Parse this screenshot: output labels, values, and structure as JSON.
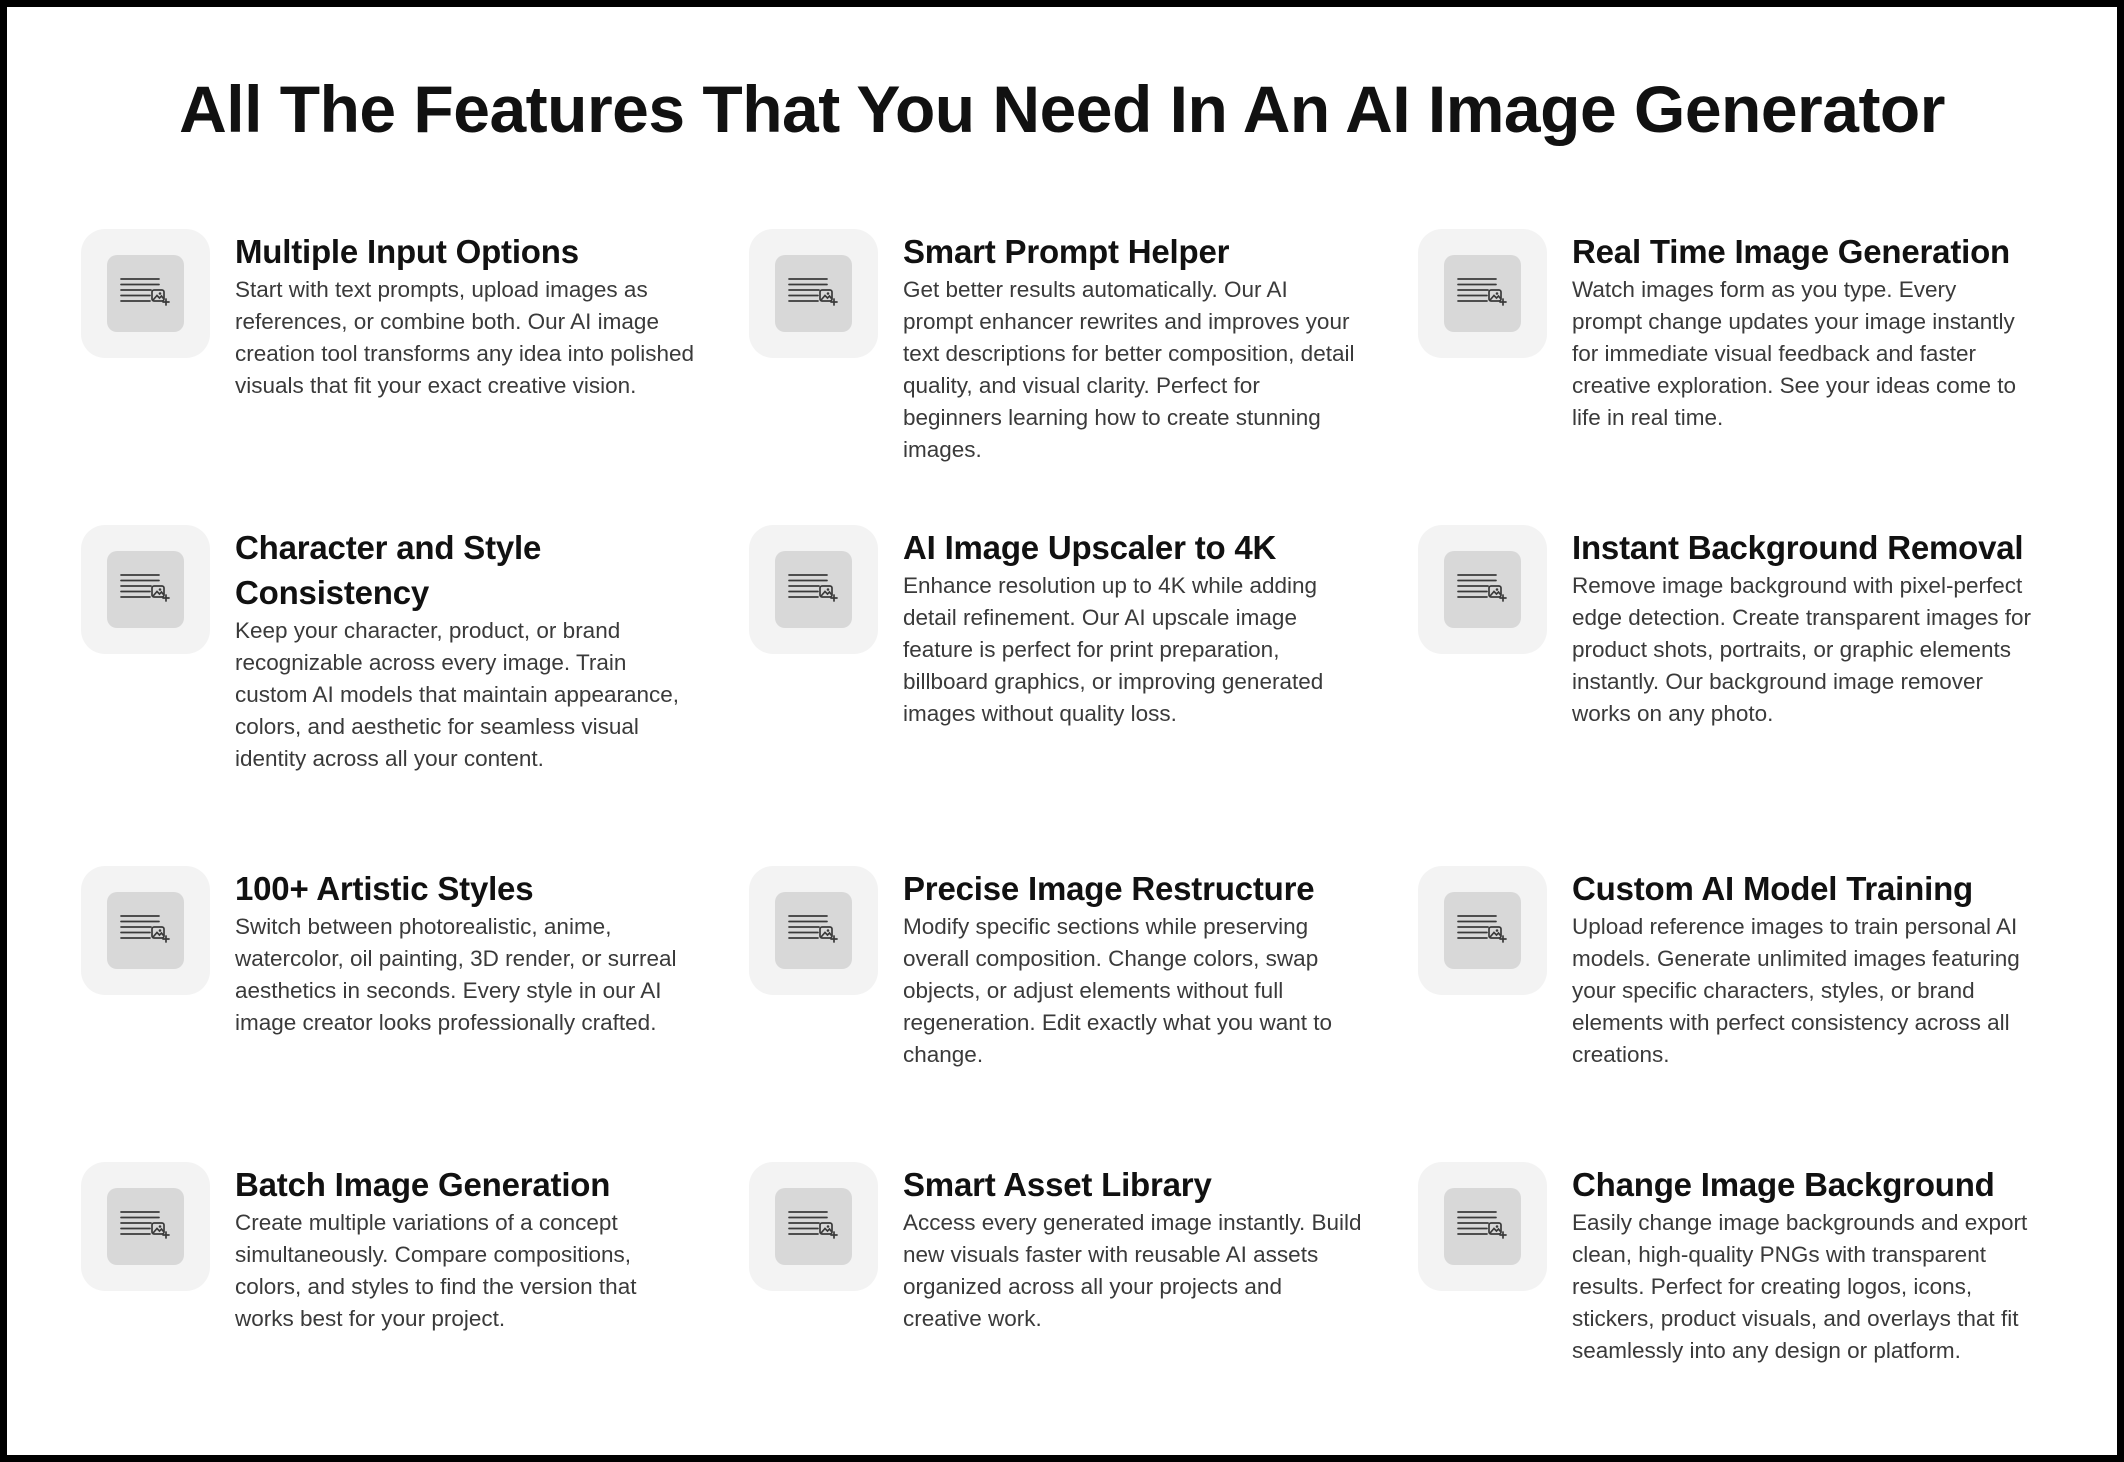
{
  "page": {
    "title": "All The Features That You Need In An AI Image Generator"
  },
  "icon_name": "text-to-image-icon",
  "features": [
    {
      "title": "Multiple Input Options",
      "description": "Start with text prompts, upload images as references, or combine both. Our AI image creation tool transforms any idea into polished visuals that fit your exact creative vision."
    },
    {
      "title": "Smart Prompt Helper",
      "description": "Get better results automatically. Our AI prompt enhancer rewrites and improves your text descriptions for better composition, detail quality, and visual clarity. Perfect for beginners learning how to create stunning images."
    },
    {
      "title": "Real Time Image Generation",
      "description": "Watch images form as you type. Every prompt change updates your image instantly for immediate visual feedback and faster creative exploration. See your ideas come to life in real time."
    },
    {
      "title": "Character and Style Consistency",
      "description": "Keep your character, product, or brand recognizable across every image. Train custom AI models that maintain appearance, colors, and aesthetic for seamless visual identity across all your content."
    },
    {
      "title": "AI Image Upscaler to 4K",
      "description": "Enhance resolution up to 4K while adding detail refinement. Our AI upscale image feature is perfect for print preparation, billboard graphics, or improving generated images without quality loss."
    },
    {
      "title": "Instant Background Removal",
      "description": "Remove image background with pixel-perfect edge detection. Create transparent images for product shots, portraits, or graphic elements instantly. Our background image remover works on any photo."
    },
    {
      "title": "100+ Artistic Styles",
      "description": "Switch between photorealistic, anime, watercolor, oil painting, 3D render, or surreal aesthetics in seconds. Every style in our AI image creator looks professionally crafted."
    },
    {
      "title": "Precise Image Restructure",
      "description": "Modify specific sections while preserving overall composition. Change colors, swap objects, or adjust elements without full regeneration. Edit exactly what you want to change."
    },
    {
      "title": "Custom AI Model Training",
      "description": "Upload reference images to train personal AI models. Generate unlimited images featuring your specific characters, styles, or brand elements with perfect consistency across all creations."
    },
    {
      "title": "Batch Image Generation",
      "description": "Create multiple variations of a concept simultaneously. Compare compositions, colors, and styles to find the version that works best for your project."
    },
    {
      "title": "Smart Asset Library",
      "description": "Access every generated image instantly. Build new visuals faster with reusable AI assets organized across all your projects and creative work."
    },
    {
      "title": "Change Image Background",
      "description": "Easily change image backgrounds and export clean, high-quality PNGs with transparent results. Perfect for creating logos, icons, stickers, product visuals, and overlays that fit seamlessly into any design or platform."
    }
  ]
}
